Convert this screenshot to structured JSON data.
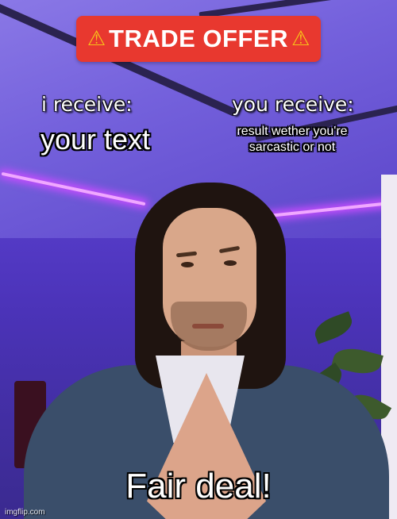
{
  "banner": {
    "warning_icon": "warning-triangle-icon",
    "title": "TRADE OFFER"
  },
  "labels": {
    "i_receive": "i receive:",
    "you_receive": "you receive:"
  },
  "captions": {
    "left": "your text",
    "right": "result wether you're sarcastic or not",
    "bottom": "Fair deal!"
  },
  "watermark": "imgflip.com",
  "colors": {
    "banner_bg": "#e8382f",
    "warning_icon": "#f7c21a",
    "text": "#ffffff",
    "lighting": "#7461dc"
  }
}
